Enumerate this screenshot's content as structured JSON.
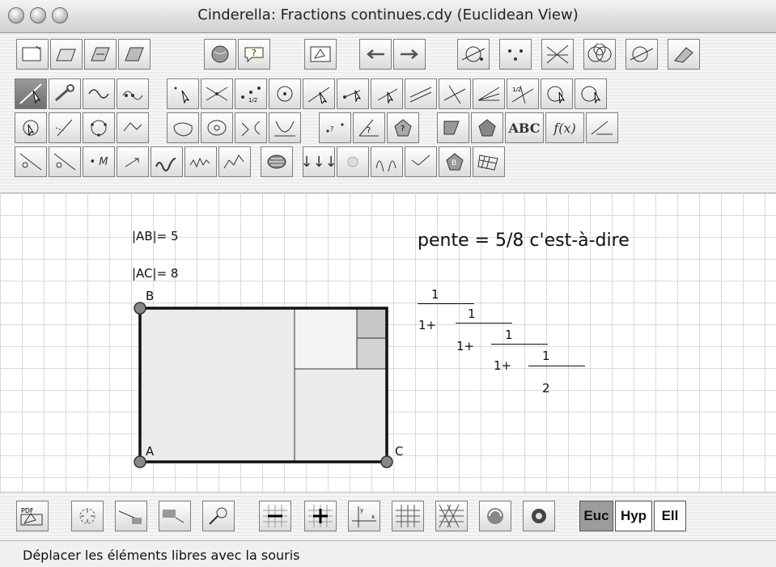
{
  "window": {
    "title": "Cinderella: Fractions continues.cdy (Euclidean View)"
  },
  "toolbar": {
    "row1_icons": [
      "new-file-icon",
      "open-file-icon",
      "save-icon",
      "save-as-icon",
      "globe-icon",
      "help-icon",
      "text-editor-icon",
      "undo-icon",
      "redo-icon",
      "point-circle-icon",
      "points-icon",
      "lines-icon",
      "circles-icon",
      "segment-circle-icon",
      "eraser-icon"
    ],
    "row2_icons": [
      "move-icon",
      "wrench-icon",
      "curve-icon",
      "multi-point-icon",
      "add-point-icon",
      "intersection-icon",
      "midpoint-icon",
      "circle-center-icon",
      "line-icon",
      "segment-icon",
      "ray-icon",
      "parallel-icon",
      "perpendicular-icon",
      "angle-bisector-icon",
      "segment-bisector-icon",
      "circle-tool-icon",
      "compass-icon"
    ],
    "row3_icons": [
      "circle-point-icon",
      "mirror-icon",
      "three-point-circle-icon",
      "polyline-icon",
      "polygon-icon",
      "concentric-icon",
      "arc-icon",
      "conic-icon",
      "distance-icon",
      "angle-measure-icon",
      "info-icon",
      "area-icon",
      "polygon-area-icon",
      "text-tool-icon",
      "function-icon",
      "locus-tool-icon"
    ],
    "row3_text": {
      "abc": "ABC",
      "fx": "f(x)"
    },
    "row4_icons": [
      "point-on-curve-icon",
      "point-on-line-icon",
      "m-point-icon",
      "vector-icon",
      "function-plot-icon",
      "trace-icon",
      "spiral-icon",
      "arrows-down-icon",
      "sparkle-icon",
      "bounce-icon",
      "zigzag-icon",
      "b-point-icon",
      "slider-icon",
      "grid-transform-icon"
    ],
    "row4_text": {
      "m": "• M"
    }
  },
  "canvas": {
    "label_ab": "|AB|= 5",
    "label_ac": "|AC|= 8",
    "point_a": "A",
    "point_b": "B",
    "point_c": "C",
    "slope_text": "pente = 5/8 c'est-à-dire",
    "fraction": {
      "n1": "1",
      "d1": "1+",
      "n2": "1",
      "d2": "1+",
      "n3": "1",
      "d3": "1+",
      "n4": "1",
      "last": "2"
    }
  },
  "bottom": {
    "icons": [
      "pdf-export-icon",
      "fit-view-icon",
      "zoom-in-view-icon",
      "zoom-out-view-icon",
      "pick-icon",
      "grid-minus-icon",
      "grid-plus-icon",
      "axes-icon",
      "grid-icon",
      "triangle-grid-icon",
      "refresh-icon",
      "camera-icon"
    ],
    "pdf_label": "PDF",
    "geometry_buttons": [
      "Euc",
      "Hyp",
      "Ell"
    ],
    "active_geometry": "Euc"
  },
  "status": {
    "text": "Déplacer les éléments libres avec la souris"
  },
  "colors": {
    "rect_fill": "#ebebeb",
    "square_fill": "#f4f4f4",
    "small_fill": "#c8c8c8",
    "point_fill": "#888888"
  }
}
